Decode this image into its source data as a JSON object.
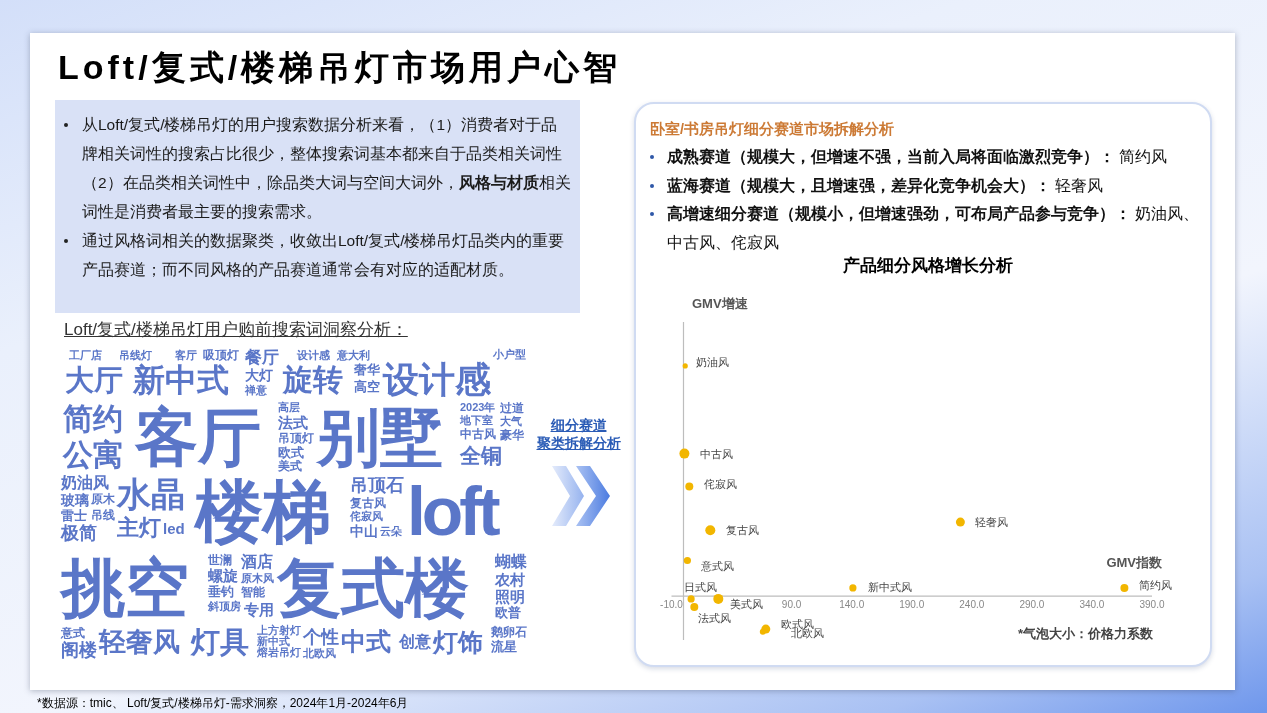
{
  "title": "Loft/复式/楼梯吊灯市场用户心智",
  "summary": {
    "bullets": [
      "从Loft/复式/楼梯吊灯的用户搜索数据分析来看，（1）消费者对于品牌相关词性的搜索占比很少，整体搜索词基本都来自于品类相关词性（2）在品类相关词性中，除品类大词与空间大词外，**风格与材质**相关词性是消费者最主要的搜索需求。",
      "通过风格词相关的数据聚类，收敛出Loft/复式/楼梯吊灯品类内的重要产品赛道；而不同风格的产品赛道通常会有对应的适配材质。"
    ]
  },
  "word_cloud": {
    "title": "Loft/复式/楼梯吊灯用户购前搜索词洞察分析：",
    "words": [
      "工厂店",
      "吊线灯",
      "客厅",
      "吸顶灯",
      "餐厅",
      "设计感",
      "意大利",
      "小户型",
      "大厅",
      "新中式",
      "大灯",
      "禅意",
      "旋转",
      "奢华",
      "高空",
      "设计感",
      "简约",
      "公寓",
      "客厅",
      "高层",
      "法式",
      "吊顶灯",
      "欧式",
      "美式",
      "别墅",
      "2023年",
      "地下室",
      "中古风",
      "全铜",
      "过道",
      "大气",
      "豪华",
      "奶油风",
      "玻璃",
      "雷士",
      "极简",
      "原木",
      "吊线",
      "水晶",
      "主灯",
      "led",
      "楼梯",
      "吊顶石",
      "复古风",
      "侘寂风",
      "中山",
      "云朵",
      "loft",
      "挑空",
      "世澜",
      "螺旋",
      "垂钓",
      "斜顶房",
      "酒店",
      "原木风",
      "智能",
      "专用",
      "复式楼",
      "蝴蝶",
      "农村",
      "照明",
      "欧普",
      "意式",
      "阁楼",
      "轻奢风",
      "灯具",
      "上方射灯",
      "新中式",
      "熔岩吊灯",
      "个性",
      "北欧风",
      "中式",
      "创意",
      "灯饰",
      "鹅卵石",
      "流星"
    ]
  },
  "transition": {
    "lines": [
      "细分赛道",
      "聚类拆解分析"
    ]
  },
  "segment_panel": {
    "heading": "卧室/书房吊灯细分赛道市场拆解分析",
    "bullets": [
      "**成熟赛道（规模大，但增速不强，当前入局将面临激烈竞争）：** 简约风",
      "**蓝海赛道（规模大，且增速强，差异化竞争机会大）：** 轻奢风",
      "**高增速细分赛道（规模小，但增速强劲，可布局产品参与竞争）：** 奶油风、中古风、侘寂风"
    ],
    "growth_chart": {
      "title": "产品细分风格增长分析",
      "y_axis_label": "GMV增速",
      "x_axis_label": "GMV指数",
      "x_ticks": [
        "-10.0",
        "90.0",
        "140.0",
        "190.0",
        "240.0",
        "290.0",
        "340.0",
        "390.0"
      ],
      "points": [
        "奶油风",
        "中古风",
        "侘寂风",
        "复古风",
        "轻奢风",
        "意式风",
        "日式风",
        "美式风",
        "法式风",
        "新中式风",
        "简约风",
        "欧式风",
        "北欧风"
      ],
      "note": "*气泡大小：价格力系数"
    }
  },
  "footnote": "*数据源：tmic、 Loft/复式/楼梯吊灯-需求洞察，2024年1月-2024年6月"
}
